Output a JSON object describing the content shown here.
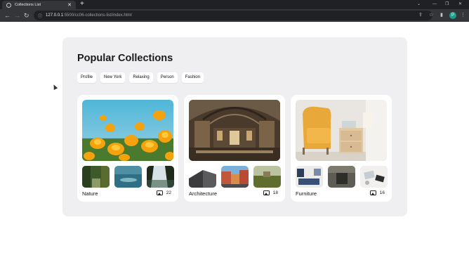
{
  "browser": {
    "tab_title": "Collections List",
    "url_host": "127.0.0.1",
    "url_path": ":5500/cc06-collections-list/index.html",
    "profile_initial": "P"
  },
  "page": {
    "heading": "Popular Collections",
    "tags": [
      "Profile",
      "New York",
      "Relaxing",
      "Person",
      "Fashion"
    ]
  },
  "cards": [
    {
      "title": "Nature",
      "count": "22"
    },
    {
      "title": "Architecture",
      "count": "18"
    },
    {
      "title": "Furniture",
      "count": "16"
    }
  ],
  "colors": {
    "panel": "#efeff1",
    "card": "#ffffff",
    "browser_dark": "#202124",
    "browser_toolbar": "#35363a"
  }
}
